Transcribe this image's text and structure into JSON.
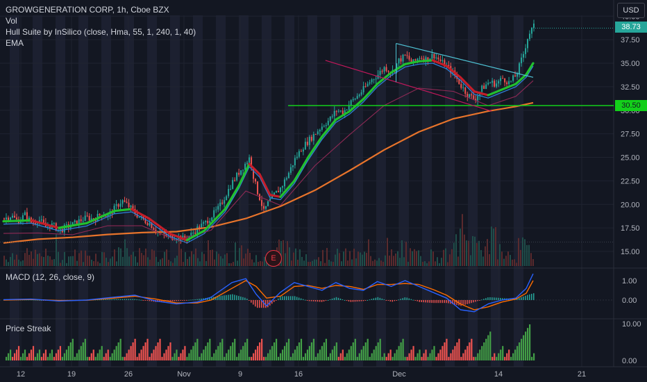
{
  "header": {
    "symbol_line": "GROWGENERATION CORP, 1h, Cboe BZX",
    "indicators": [
      "Vol",
      "Hull Suite by InSilico (close, Hma, 55, 1, 240, 1, 40)",
      "EMA"
    ],
    "currency": "USD"
  },
  "price_axis": {
    "ticks": [
      "40.00",
      "37.50",
      "35.00",
      "32.50",
      "30.00",
      "27.50",
      "25.00",
      "22.50",
      "20.00",
      "17.50",
      "15.00"
    ],
    "last_price": "38.73",
    "level_label": "30.50"
  },
  "macd": {
    "label": "MACD (12, 26, close, 9)",
    "ticks": [
      "1.00",
      "0.00"
    ]
  },
  "streak": {
    "label": "Price Streak",
    "ticks": [
      "10.00",
      "0.00"
    ]
  },
  "time_axis": {
    "ticks": [
      "12",
      "19",
      "26",
      "Nov",
      "9",
      "16",
      "Dec",
      "14",
      "21"
    ]
  },
  "earnings_badge": "E",
  "colors": {
    "up": "#26a69a",
    "down": "#ef5350",
    "hull_up": "#22c02f",
    "hull_down": "#c41e2a",
    "ema": "#e8742b",
    "level": "#13cf1a",
    "trend_top": "#4fc3d5",
    "trend_bot": "#c2185b",
    "macd": "#2962ff",
    "signal": "#ff6d00"
  },
  "chart_data": {
    "type": "line",
    "title": "GROWGENERATION CORP, 1h, Cboe BZX",
    "ylim": [
      14,
      40.5
    ],
    "x_ticks": [
      "12",
      "19",
      "26",
      "Nov",
      "9",
      "16",
      "Dec",
      "14",
      "21"
    ],
    "price_path": [
      [
        0,
        18.5
      ],
      [
        10,
        18.8
      ],
      [
        20,
        18.2
      ],
      [
        30,
        18.9
      ],
      [
        40,
        18.0
      ],
      [
        50,
        18.4
      ],
      [
        60,
        17.6
      ],
      [
        70,
        17.8
      ],
      [
        80,
        17.2
      ],
      [
        90,
        17.6
      ],
      [
        100,
        17.9
      ],
      [
        110,
        18.3
      ],
      [
        120,
        18.6
      ],
      [
        130,
        18.4
      ],
      [
        140,
        19.0
      ],
      [
        150,
        18.8
      ],
      [
        160,
        19.6
      ],
      [
        170,
        20.4
      ],
      [
        180,
        19.8
      ],
      [
        190,
        19.0
      ],
      [
        200,
        18.4
      ],
      [
        210,
        18.0
      ],
      [
        220,
        17.2
      ],
      [
        230,
        16.8
      ],
      [
        240,
        16.5
      ],
      [
        250,
        16.6
      ],
      [
        260,
        16.3
      ],
      [
        270,
        16.8
      ],
      [
        280,
        17.5
      ],
      [
        290,
        18.0
      ],
      [
        300,
        18.8
      ],
      [
        310,
        19.6
      ],
      [
        320,
        21.0
      ],
      [
        330,
        22.4
      ],
      [
        340,
        23.5
      ],
      [
        350,
        24.5
      ],
      [
        355,
        25.0
      ],
      [
        360,
        23.0
      ],
      [
        365,
        21.5
      ],
      [
        370,
        20.5
      ],
      [
        375,
        19.2
      ],
      [
        380,
        20.0
      ],
      [
        390,
        21.0
      ],
      [
        400,
        21.8
      ],
      [
        410,
        23.2
      ],
      [
        420,
        24.8
      ],
      [
        430,
        26.0
      ],
      [
        440,
        26.8
      ],
      [
        450,
        27.6
      ],
      [
        460,
        28.4
      ],
      [
        470,
        29.0
      ],
      [
        480,
        30.0
      ],
      [
        490,
        29.8
      ],
      [
        500,
        30.8
      ],
      [
        510,
        31.5
      ],
      [
        520,
        32.3
      ],
      [
        530,
        33.2
      ],
      [
        540,
        33.8
      ],
      [
        550,
        34.6
      ],
      [
        560,
        34.0
      ],
      [
        570,
        35.3
      ],
      [
        580,
        35.8
      ],
      [
        590,
        35.0
      ],
      [
        600,
        35.7
      ],
      [
        610,
        35.4
      ],
      [
        620,
        35.9
      ],
      [
        630,
        35.2
      ],
      [
        640,
        34.6
      ],
      [
        650,
        33.8
      ],
      [
        660,
        32.6
      ],
      [
        670,
        31.6
      ],
      [
        680,
        31.2
      ],
      [
        690,
        32.3
      ],
      [
        700,
        33.0
      ],
      [
        710,
        32.8
      ],
      [
        720,
        33.4
      ],
      [
        730,
        32.9
      ],
      [
        740,
        33.8
      ],
      [
        750,
        36.0
      ],
      [
        757,
        38.0
      ],
      [
        765,
        38.9
      ]
    ],
    "hull_path": [
      [
        0,
        18.2
      ],
      [
        40,
        18.3
      ],
      [
        80,
        17.5
      ],
      [
        120,
        18.0
      ],
      [
        160,
        19.3
      ],
      [
        185,
        19.5
      ],
      [
        210,
        18.5
      ],
      [
        240,
        16.9
      ],
      [
        265,
        16.2
      ],
      [
        290,
        17.2
      ],
      [
        320,
        19.5
      ],
      [
        340,
        22.0
      ],
      [
        355,
        24.3
      ],
      [
        370,
        23.2
      ],
      [
        385,
        21.0
      ],
      [
        400,
        20.8
      ],
      [
        420,
        22.5
      ],
      [
        440,
        25.0
      ],
      [
        460,
        27.2
      ],
      [
        480,
        29.0
      ],
      [
        500,
        29.9
      ],
      [
        520,
        31.2
      ],
      [
        540,
        32.8
      ],
      [
        560,
        34.0
      ],
      [
        580,
        34.9
      ],
      [
        600,
        35.2
      ],
      [
        620,
        35.3
      ],
      [
        640,
        34.7
      ],
      [
        660,
        33.5
      ],
      [
        680,
        32.0
      ],
      [
        700,
        31.6
      ],
      [
        720,
        32.2
      ],
      [
        740,
        32.8
      ],
      [
        755,
        33.8
      ],
      [
        765,
        35.0
      ]
    ],
    "ema_path": [
      [
        0,
        15.9
      ],
      [
        50,
        16.3
      ],
      [
        100,
        16.5
      ],
      [
        150,
        16.8
      ],
      [
        200,
        17.0
      ],
      [
        250,
        17.1
      ],
      [
        300,
        17.6
      ],
      [
        350,
        18.5
      ],
      [
        400,
        19.8
      ],
      [
        450,
        21.5
      ],
      [
        500,
        23.6
      ],
      [
        550,
        25.8
      ],
      [
        600,
        27.7
      ],
      [
        650,
        29.1
      ],
      [
        700,
        29.9
      ],
      [
        740,
        30.4
      ],
      [
        765,
        30.8
      ]
    ],
    "horizontal_level": 30.5,
    "channel_top": [
      [
        567,
        37.1
      ],
      [
        765,
        33.5
      ]
    ],
    "channel_bottom": [
      [
        465,
        35.3
      ],
      [
        705,
        29.9
      ]
    ],
    "macd_ylim": [
      -0.9,
      1.45
    ],
    "macd_path": [
      [
        0,
        0.02
      ],
      [
        40,
        0.05
      ],
      [
        80,
        -0.05
      ],
      [
        120,
        0.0
      ],
      [
        160,
        0.15
      ],
      [
        190,
        0.25
      ],
      [
        220,
        -0.05
      ],
      [
        250,
        -0.2
      ],
      [
        280,
        -0.1
      ],
      [
        300,
        0.15
      ],
      [
        330,
        0.9
      ],
      [
        350,
        1.1
      ],
      [
        365,
        0.3
      ],
      [
        380,
        -0.3
      ],
      [
        400,
        0.4
      ],
      [
        420,
        0.9
      ],
      [
        440,
        0.7
      ],
      [
        460,
        0.5
      ],
      [
        480,
        0.9
      ],
      [
        500,
        0.6
      ],
      [
        520,
        0.5
      ],
      [
        540,
        0.95
      ],
      [
        560,
        0.7
      ],
      [
        580,
        1.0
      ],
      [
        600,
        0.7
      ],
      [
        620,
        0.4
      ],
      [
        640,
        0.1
      ],
      [
        660,
        -0.5
      ],
      [
        680,
        -0.6
      ],
      [
        700,
        -0.2
      ],
      [
        720,
        0.0
      ],
      [
        740,
        0.1
      ],
      [
        755,
        0.6
      ],
      [
        765,
        1.35
      ]
    ],
    "signal_path": [
      [
        0,
        0.0
      ],
      [
        40,
        0.03
      ],
      [
        80,
        -0.02
      ],
      [
        120,
        -0.01
      ],
      [
        160,
        0.1
      ],
      [
        190,
        0.2
      ],
      [
        220,
        0.05
      ],
      [
        250,
        -0.15
      ],
      [
        280,
        -0.15
      ],
      [
        300,
        0.0
      ],
      [
        330,
        0.6
      ],
      [
        350,
        1.0
      ],
      [
        365,
        0.7
      ],
      [
        380,
        0.1
      ],
      [
        400,
        0.2
      ],
      [
        420,
        0.7
      ],
      [
        440,
        0.75
      ],
      [
        460,
        0.6
      ],
      [
        480,
        0.75
      ],
      [
        500,
        0.7
      ],
      [
        520,
        0.55
      ],
      [
        540,
        0.8
      ],
      [
        560,
        0.8
      ],
      [
        580,
        0.85
      ],
      [
        600,
        0.8
      ],
      [
        620,
        0.55
      ],
      [
        640,
        0.25
      ],
      [
        660,
        -0.2
      ],
      [
        680,
        -0.5
      ],
      [
        700,
        -0.35
      ],
      [
        720,
        -0.1
      ],
      [
        740,
        0.05
      ],
      [
        755,
        0.35
      ],
      [
        765,
        1.0
      ]
    ],
    "streak_ylim": [
      -0.5,
      10.5
    ]
  }
}
